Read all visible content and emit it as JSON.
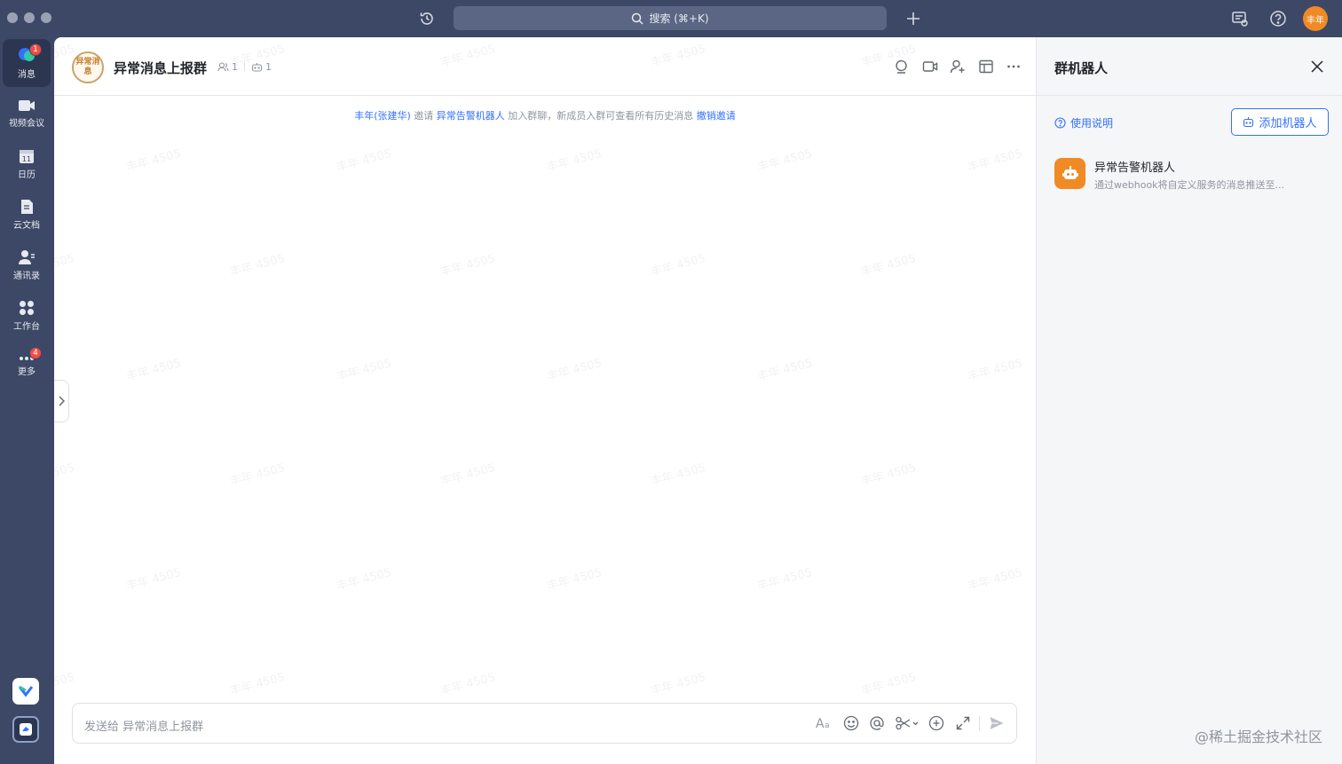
{
  "titlebar": {
    "search_label": "搜索 (⌘+K)",
    "avatar_text": "丰年"
  },
  "rail": {
    "items": [
      {
        "label": "消息",
        "badge": "1"
      },
      {
        "label": "视频会议"
      },
      {
        "label": "日历"
      },
      {
        "label": "云文档"
      },
      {
        "label": "通讯录"
      },
      {
        "label": "工作台"
      },
      {
        "label": "更多",
        "badge": "4"
      }
    ]
  },
  "chat": {
    "avatar_text": "异常消息",
    "title": "异常消息上报群",
    "member_count": "1",
    "bot_count": "1",
    "system_message": {
      "inviter": "丰年(张建华)",
      "verb": "邀请",
      "invitee": "异常告警机器人",
      "rest": "加入群聊，新成员入群可查看所有历史消息",
      "revoke": "撤销邀请"
    },
    "watermark": "丰年 4505",
    "composer_placeholder": "发送给 异常消息上报群"
  },
  "side_panel": {
    "title": "群机器人",
    "help_label": "使用说明",
    "add_bot_label": "添加机器人",
    "bots": [
      {
        "name": "异常告警机器人",
        "description": "通过webhook将自定义服务的消息推送至..."
      }
    ]
  },
  "corner_watermark": "@稀土掘金技术社区",
  "colors": {
    "accent": "#3370ff",
    "rail_bg": "#3d4866",
    "badge": "#f54a45",
    "bot_orange": "#f08a24"
  }
}
